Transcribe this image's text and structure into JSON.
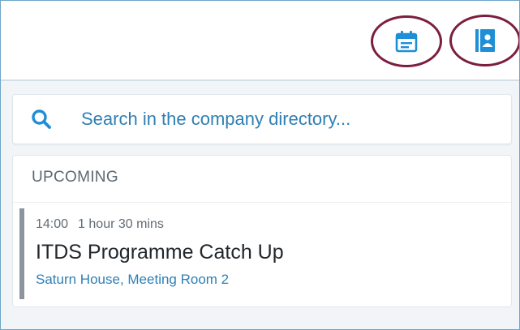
{
  "header": {
    "icons": {
      "calendar": "calendar-icon",
      "directory": "contact-book-icon"
    },
    "accent_color": "#1e8fd6",
    "highlight_color": "#7b1e3f"
  },
  "search": {
    "icon": "search-icon",
    "placeholder": "Search in the company directory..."
  },
  "upcoming": {
    "title": "UPCOMING",
    "meetings": [
      {
        "time": "14:00",
        "duration": "1 hour 30 mins",
        "title": "ITDS Programme Catch Up",
        "location": "Saturn House, Meeting Room 2"
      }
    ]
  }
}
